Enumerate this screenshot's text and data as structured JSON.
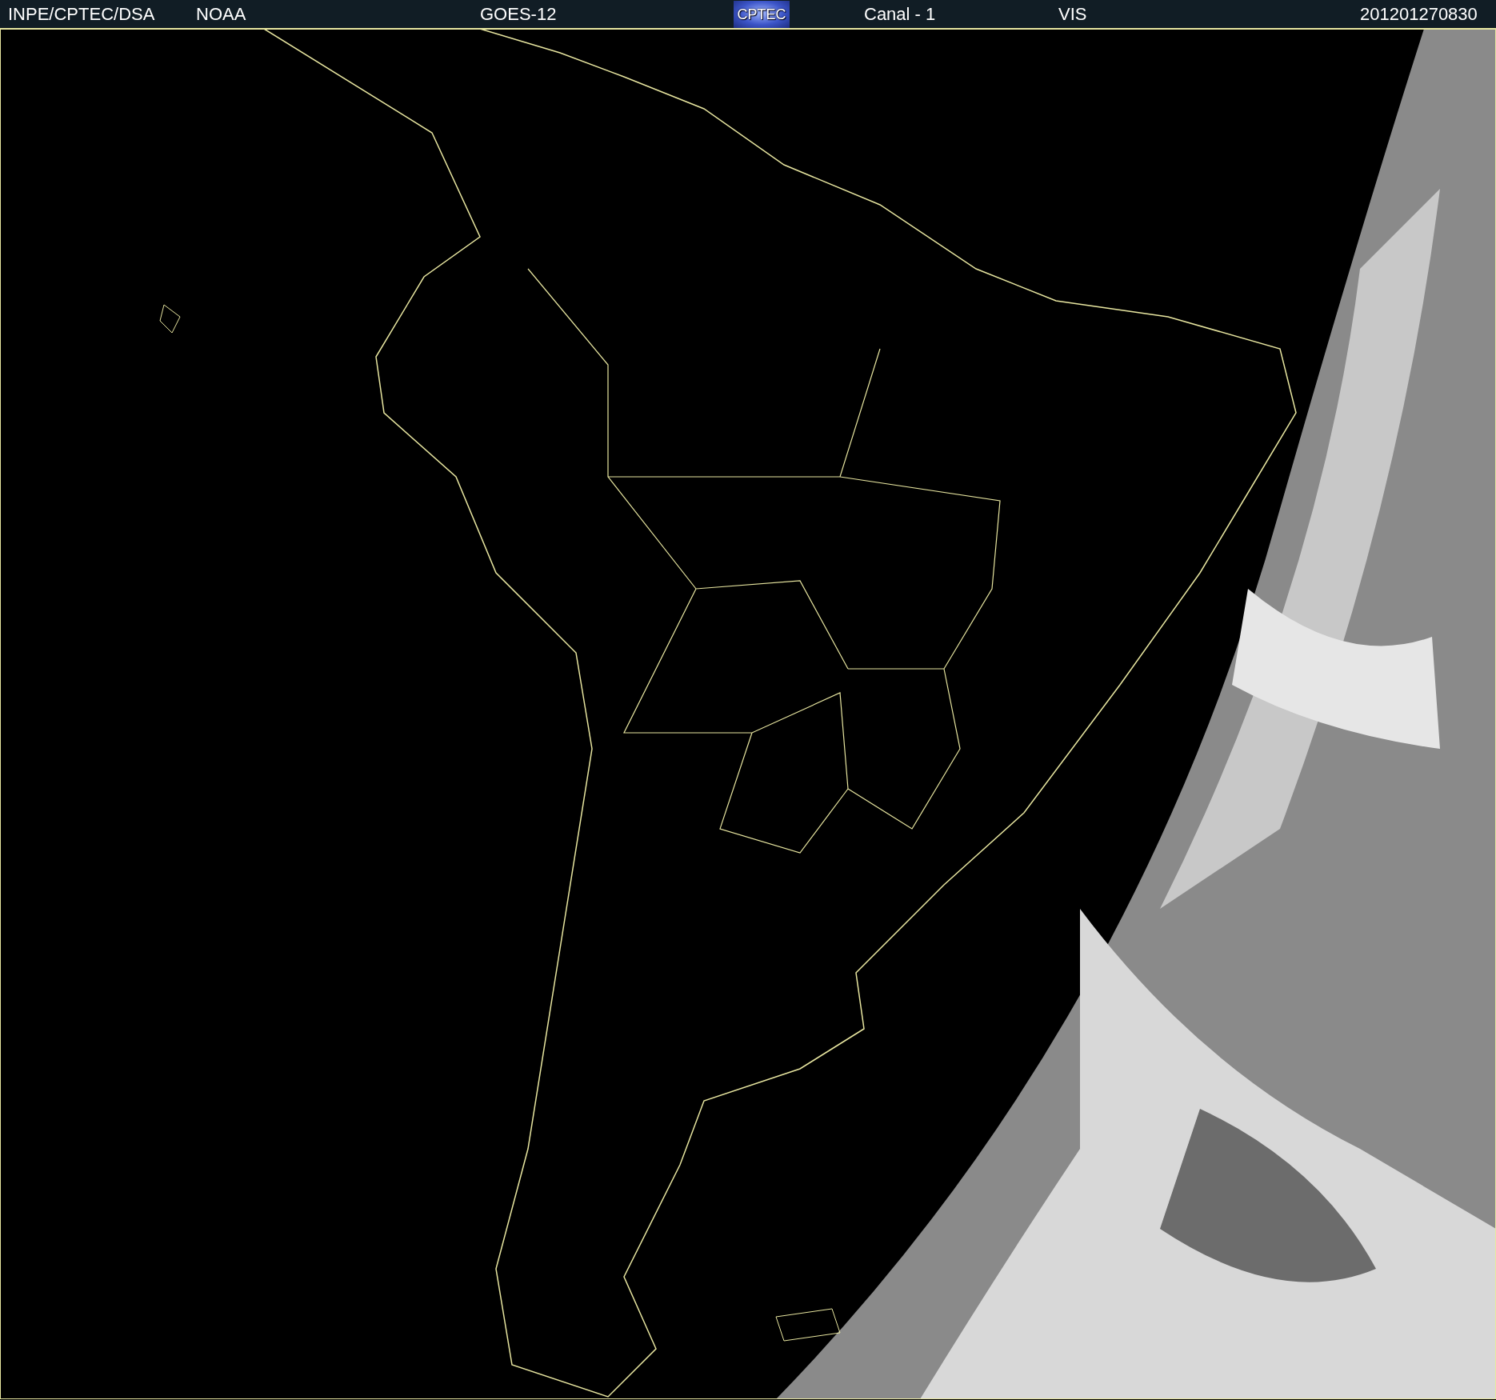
{
  "header": {
    "source": "INPE/CPTEC/DSA",
    "agency": "NOAA",
    "satellite": "GOES-12",
    "logo": "CPTEC",
    "channel": "Canal - 1",
    "band": "VIS",
    "timestamp": "201201270830"
  },
  "image": {
    "kind": "map-picture"
  }
}
